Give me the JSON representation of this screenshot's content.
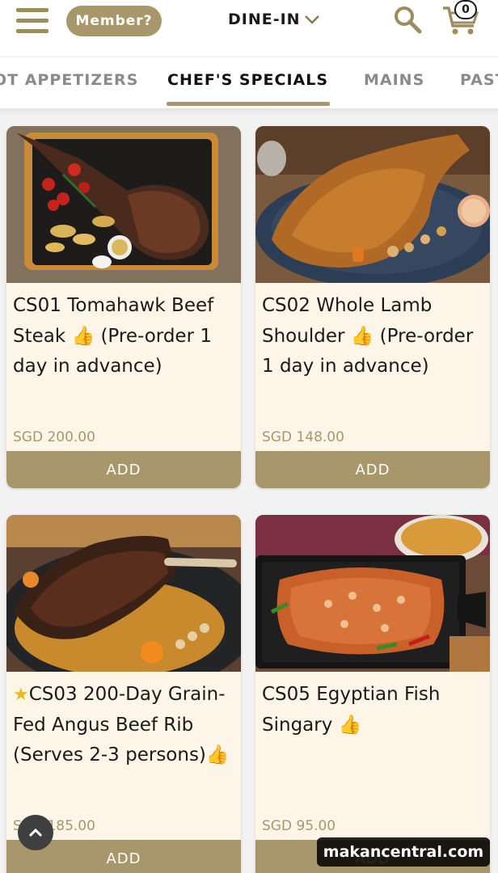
{
  "header": {
    "member_label": "Member?",
    "mode_label": "DINE-IN",
    "cart_count": "0"
  },
  "tabs": [
    {
      "label": "OT APPETIZERS"
    },
    {
      "label": "CHEF'S SPECIALS"
    },
    {
      "label": "MAINS"
    },
    {
      "label": "PAST"
    }
  ],
  "items": [
    {
      "title": "CS01 Tomahawk Beef Steak 👍 (Pre-order 1 day in advance)",
      "price": "SGD 200.00",
      "add_label": "ADD"
    },
    {
      "title": "CS02 Whole Lamb Shoulder 👍 (Pre-order 1 day in advance)",
      "price": "SGD 148.00",
      "add_label": "ADD"
    },
    {
      "title": "CS03 200-Day Grain-Fed Angus Beef Rib (Serves 2-3 persons)👍",
      "price": "SGD 185.00",
      "add_label": "ADD",
      "starred": true
    },
    {
      "title": "CS05 Egyptian Fish Singary 👍",
      "price": "SGD 95.00",
      "add_label": "ADD"
    }
  ],
  "watermark": "makancentral.com",
  "colors": {
    "accent": "#a8976b",
    "card_bg": "#fdf6e8"
  }
}
